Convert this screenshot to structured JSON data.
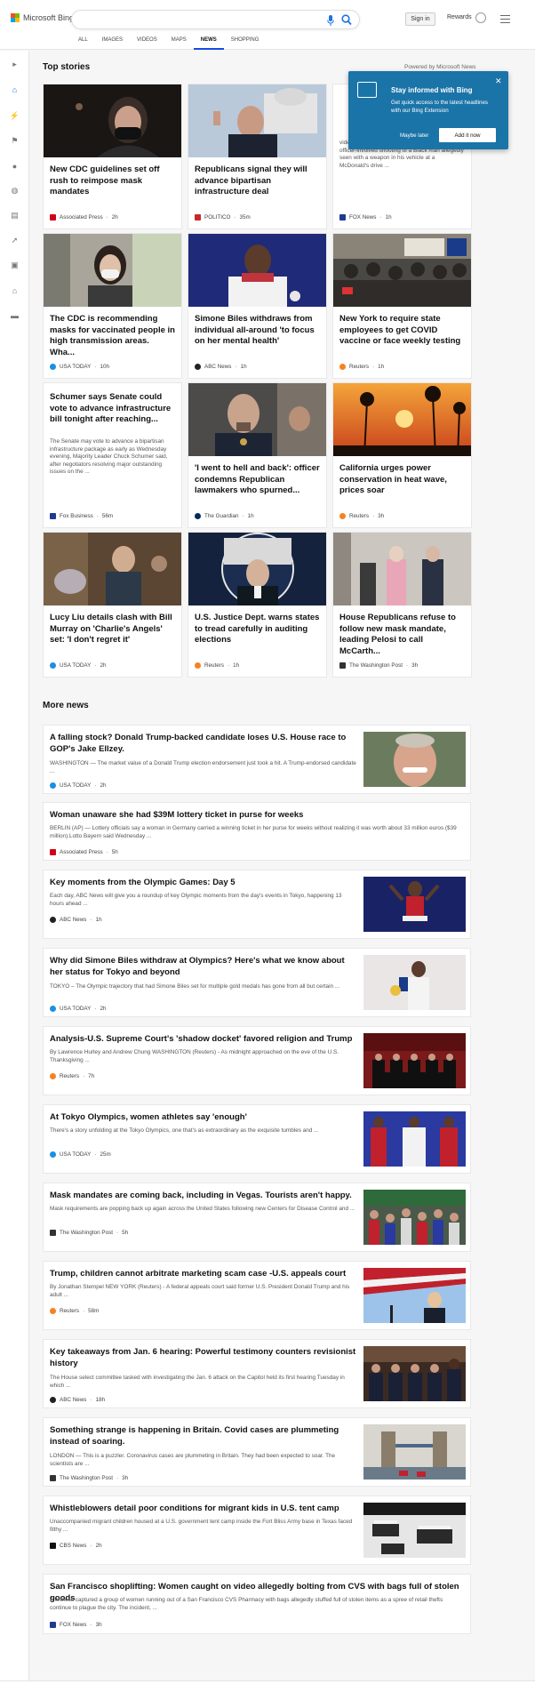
{
  "header": {
    "logo": "Microsoft Bing",
    "search_value": "",
    "sign_in": "Sign in",
    "rewards": "Rewards"
  },
  "nav": [
    "ALL",
    "IMAGES",
    "VIDEOS",
    "MAPS",
    "NEWS",
    "SHOPPING"
  ],
  "nav_active": "NEWS",
  "top_stories": {
    "title": "Top stories",
    "powered": "Powered by Microsoft News",
    "cards": [
      {
        "title": "New CDC guidelines set off rush to reimpose mask mandates",
        "source": "Associated Press",
        "time": "2h"
      },
      {
        "title": "Republicans signal they will advance bipartisan infrastructure deal",
        "source": "POLITICO",
        "time": "35m"
      },
      {
        "title": "",
        "snippet": "video at a press conference Tuesday of the fatal officer-involved shooting of a Black man allegedly seen with a weapon in his vehicle at a McDonald's drive ...",
        "source": "FOX News",
        "time": "1h"
      },
      {
        "title": "The CDC is recommending masks for vaccinated people in high transmission areas. Wha...",
        "source": "USA TODAY",
        "time": "10h"
      },
      {
        "title": "Simone Biles withdraws from individual all-around 'to focus on her mental health'",
        "source": "ABC News",
        "time": "1h"
      },
      {
        "title": "New York to require state employees to get COVID vaccine or face weekly testing",
        "source": "Reuters",
        "time": "1h"
      },
      {
        "title": "Schumer says Senate could vote to advance infrastructure bill tonight after reaching...",
        "snippet": "The Senate may vote to advance a bipartisan infrastructure package as early as Wednesday evening, Majority Leader Chuck Schumer said, after negotiators resolving major outstanding issues on the ...",
        "source": "Fox Business",
        "time": "56m"
      },
      {
        "title": "'I went to hell and back': officer condemns Republican lawmakers who spurned...",
        "source": "The Guardian",
        "time": "1h"
      },
      {
        "title": "California urges power conservation in heat wave, prices soar",
        "source": "Reuters",
        "time": "3h"
      },
      {
        "title": "Lucy Liu details clash with Bill Murray on 'Charlie's Angels' set: 'I don't regret it'",
        "source": "USA TODAY",
        "time": "2h"
      },
      {
        "title": "U.S. Justice Dept. warns states to tread carefully in auditing elections",
        "source": "Reuters",
        "time": "1h"
      },
      {
        "title": "House Republicans refuse to follow new mask mandate, leading Pelosi to call McCarth...",
        "source": "The Washington Post",
        "time": "3h"
      }
    ]
  },
  "popup": {
    "title": "Stay informed with Bing",
    "text": "Get quick access to the latest headlines with our Bing Extension",
    "later": "Maybe later",
    "add": "Add it now"
  },
  "more_news": {
    "title": "More news",
    "items": [
      {
        "title": "A falling stock? Donald Trump-backed candidate loses U.S. House race to GOP's Jake Ellzey.",
        "snippet": "WASHINGTON — The market value of a Donald Trump election endorsement just took a hit. A Trump-endorsed candidate ...",
        "source": "USA TODAY",
        "time": "2h"
      },
      {
        "title": "Woman unaware she had $39M lottery ticket in purse for weeks",
        "snippet": "BERLIN (AP) — Lottery officials say a woman in Germany carried a winning ticket in her purse for weeks without realizing it was worth about 33 million euros ($39 million).Lotto Bayern said Wednesday ...",
        "source": "Associated Press",
        "time": "5h"
      },
      {
        "title": "Key moments from the Olympic Games: Day 5",
        "snippet": "Each day, ABC News will give you a roundup of key Olympic moments from the day's events in Tokyo, happening 13 hours ahead ...",
        "source": "ABC News",
        "time": "1h"
      },
      {
        "title": "Why did Simone Biles withdraw at Olympics? Here's what we know about her status for Tokyo and beyond",
        "snippet": "TOKYO – The Olympic trajectory that had Simone Biles set for multiple gold medals has gone from all but certain ...",
        "source": "USA TODAY",
        "time": "2h"
      },
      {
        "title": "Analysis-U.S. Supreme Court's 'shadow docket' favored religion and Trump",
        "snippet": "By Lawrence Hurley and Andrew Chung WASHINGTON (Reuters) - As midnight approached on the eve of the U.S. Thanksgiving ...",
        "source": "Reuters",
        "time": "7h"
      },
      {
        "title": "At Tokyo Olympics, women athletes say 'enough'",
        "snippet": "There's a story unfolding at the Tokyo Olympics, one that's as extraordinary as the exquisite tumbles and ...",
        "source": "USA TODAY",
        "time": "25m"
      },
      {
        "title": "Mask mandates are coming back, including in Vegas. Tourists aren't happy.",
        "snippet": "Mask requirements are popping back up again across the United States following new Centers for Disease Control and ...",
        "source": "The Washington Post",
        "time": "5h"
      },
      {
        "title": "Trump, children cannot arbitrate marketing scam case -U.S. appeals court",
        "snippet": "By Jonathan Stempel NEW YORK (Reuters) - A federal appeals court said former U.S. President Donald Trump and his adult ...",
        "source": "Reuters",
        "time": "58m"
      },
      {
        "title": "Key takeaways from Jan. 6 hearing: Powerful testimony counters revisionist history",
        "snippet": "The House select committee tasked with investigating the Jan. 6 attack on the Capitol held its first hearing Tuesday in which ...",
        "source": "ABC News",
        "time": "18h"
      },
      {
        "title": "Something strange is happening in Britain. Covid cases are plummeting instead of soaring.",
        "snippet": "LONDON — This is a puzzler. Coronavirus cases are plummeting in Britain. They had been expected to soar. The scientists are ...",
        "source": "The Washington Post",
        "time": "3h"
      },
      {
        "title": "Whistleblowers detail poor conditions for migrant kids in U.S. tent camp",
        "snippet": "Unaccompanied migrant children housed at a U.S. government tent camp inside the Fort Bliss Army base in Texas faced filthy ...",
        "source": "CBS News",
        "time": "2h"
      },
      {
        "title": "San Francisco shoplifting: Women caught on video allegedly bolting from CVS with bags full of stolen goods",
        "snippet": "A witness captured a group of women running out of a San Francisco CVS Pharmacy with bags allegedly stuffed full of stolen items as a spree of retail thefts continue to plague the city. The incident, ...",
        "source": "FOX News",
        "time": "3h"
      }
    ]
  },
  "source_colors": {
    "Associated Press": "#d0021b",
    "POLITICO": "#c62828",
    "FOX News": "#1f3a93",
    "USA TODAY": "#1a8fe3",
    "ABC News": "#222222",
    "Reuters": "#f58220",
    "Fox Business": "#1f3a93",
    "The Guardian": "#052962",
    "The Washington Post": "#333333",
    "CBS News": "#111111"
  }
}
